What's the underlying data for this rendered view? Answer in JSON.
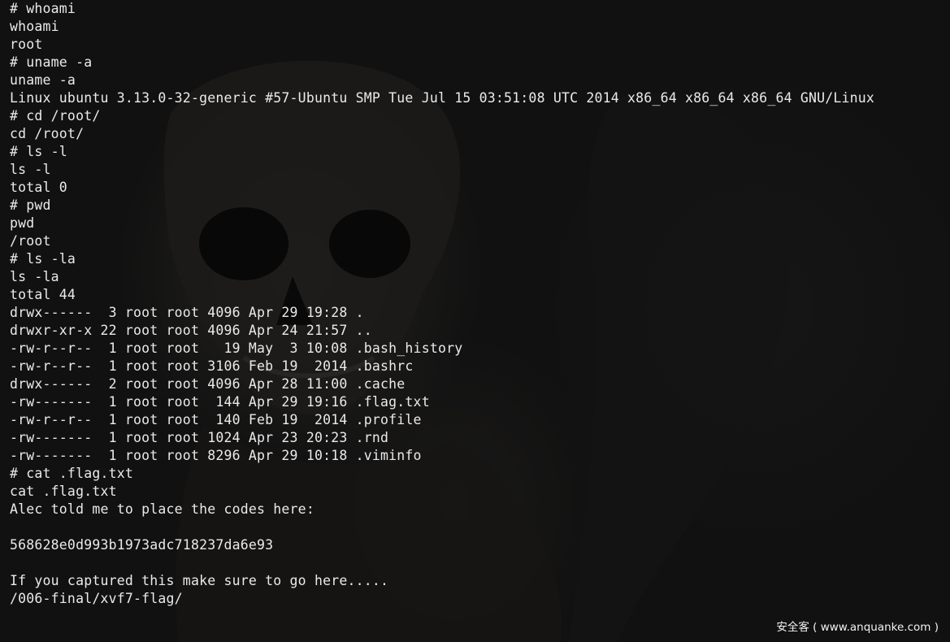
{
  "terminal": {
    "lines": [
      "# whoami",
      "whoami",
      "root",
      "# uname -a",
      "uname -a",
      "Linux ubuntu 3.13.0-32-generic #57-Ubuntu SMP Tue Jul 15 03:51:08 UTC 2014 x86_64 x86_64 x86_64 GNU/Linux",
      "# cd /root/",
      "cd /root/",
      "# ls -l",
      "ls -l",
      "total 0",
      "# pwd",
      "pwd",
      "/root",
      "# ls -la",
      "ls -la",
      "total 44",
      "drwx------  3 root root 4096 Apr 29 19:28 .",
      "drwxr-xr-x 22 root root 4096 Apr 24 21:57 ..",
      "-rw-r--r--  1 root root   19 May  3 10:08 .bash_history",
      "-rw-r--r--  1 root root 3106 Feb 19  2014 .bashrc",
      "drwx------  2 root root 4096 Apr 28 11:00 .cache",
      "-rw-------  1 root root  144 Apr 29 19:16 .flag.txt",
      "-rw-r--r--  1 root root  140 Feb 19  2014 .profile",
      "-rw-------  1 root root 1024 Apr 23 20:23 .rnd",
      "-rw-------  1 root root 8296 Apr 29 10:18 .viminfo",
      "# cat .flag.txt",
      "cat .flag.txt",
      "Alec told me to place the codes here:",
      "",
      "568628e0d993b1973adc718237da6e93",
      "",
      "If you captured this make sure to go here.....",
      "/006-final/xvf7-flag/"
    ],
    "prompt": "#",
    "cursor_icon": "block-cursor"
  },
  "watermark": {
    "text": "安全客 ( www.anquanke.com )"
  },
  "colors": {
    "background": "#111111",
    "text": "#eaeaea"
  }
}
